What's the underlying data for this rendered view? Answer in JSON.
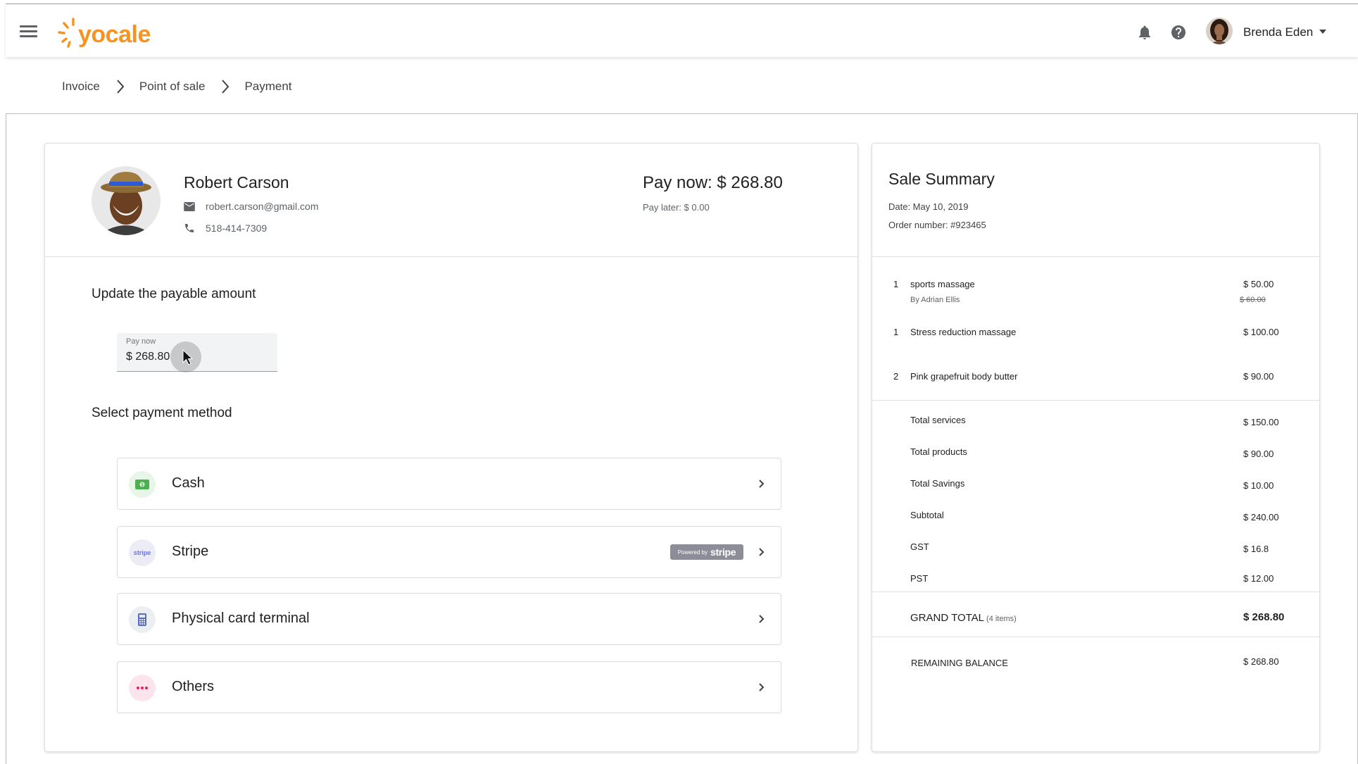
{
  "brand": {
    "logo_text": "yocale",
    "color": "#f7931e"
  },
  "topbar": {
    "icons": [
      "menu-icon",
      "bell-icon",
      "help-icon"
    ],
    "user_name": "Brenda Eden"
  },
  "breadcrumb": [
    "Invoice",
    "Point of sale",
    "Payment"
  ],
  "client": {
    "name": "Robert Carson",
    "email": "robert.carson@gmail.com",
    "phone": "518-414-7309"
  },
  "payment": {
    "pay_now_heading": "Pay now:  $ 268.80",
    "pay_later": "Pay later:  $ 0.00",
    "update_title": "Update the payable amount",
    "field_label": "Pay now",
    "field_value": "$ 268.80",
    "method_title": "Select payment method",
    "methods": [
      {
        "label": "Cash",
        "icon": "cash-icon"
      },
      {
        "label": "Stripe",
        "icon": "stripe-icon",
        "badge_prefix": "Powered by",
        "badge_brand": "stripe"
      },
      {
        "label": "Physical card terminal",
        "icon": "card-terminal-icon"
      },
      {
        "label": "Others",
        "icon": "more-icon"
      }
    ]
  },
  "summary": {
    "title": "Sale Summary",
    "date": "Date: May 10, 2019",
    "order": "Order number: #923465",
    "items": [
      {
        "qty": "1",
        "name": "sports massage",
        "sub": "By Adrian Ellis",
        "price": "$ 50.00",
        "original": "$ 60.00"
      },
      {
        "qty": "1",
        "name": "Stress reduction massage",
        "price": "$ 100.00"
      },
      {
        "qty": "2",
        "name": "Pink grapefruit body butter",
        "price": "$ 90.00"
      }
    ],
    "totals": [
      {
        "label": "Total services",
        "value": "$ 150.00"
      },
      {
        "label": "Total products",
        "value": "$ 90.00"
      },
      {
        "label": "Total Savings",
        "value": "$ 10.00"
      },
      {
        "label": "Subtotal",
        "value": "$ 240.00"
      },
      {
        "label": "GST",
        "value": "$ 16.8"
      },
      {
        "label": "PST",
        "value": "$ 12.00"
      }
    ],
    "grand_total_label": "GRAND TOTAL",
    "grand_total_items": "(4 items)",
    "grand_total_value": "$ 268.80",
    "remaining_label": "REMAINING BALANCE",
    "remaining_value": "$ 268.80"
  }
}
